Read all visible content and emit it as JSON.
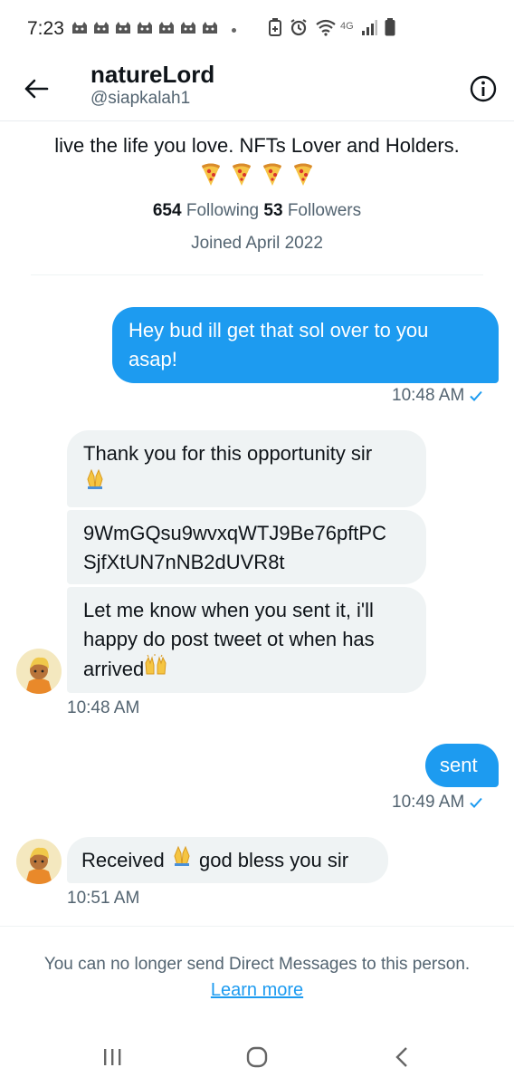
{
  "status_bar": {
    "time": "7:23",
    "network": "4G",
    "notification_icons": [
      "cat-icon",
      "cat-icon",
      "cat-icon",
      "cat-icon",
      "cat-icon",
      "cat-icon",
      "cat-icon"
    ]
  },
  "header": {
    "name": "natureLord",
    "handle": "@siapkalah1"
  },
  "profile": {
    "bio": "live the life you love.  NFTs Lover and Holders.",
    "bio_emoji": [
      "pizza",
      "pizza",
      "pizza",
      "pizza"
    ],
    "following_count": "654",
    "following_label": "Following",
    "followers_count": "53",
    "followers_label": "Followers",
    "joined": "Joined April 2022"
  },
  "messages": [
    {
      "direction": "sent",
      "lines": [
        "Hey bud ill get that sol over to you",
        "asap!"
      ],
      "time": "10:48 AM"
    },
    {
      "direction": "received",
      "lines": [
        "Thank you for this opportunity sir"
      ],
      "emoji": "folded-hands"
    },
    {
      "direction": "received",
      "lines": [
        "9WmGQsu9wvxqWTJ9Be76pftPC",
        "SjfXtUN7nNB2dUVR8t"
      ]
    },
    {
      "direction": "received",
      "lines": [
        "Let me know when you sent it, i'll",
        "happy do post tweet ot when has",
        "arrived"
      ],
      "emoji": "raising-hands",
      "time": "10:48 AM"
    },
    {
      "direction": "sent",
      "lines": [
        "sent"
      ],
      "time": "10:49 AM"
    },
    {
      "direction": "received",
      "lines": [
        "Received",
        "god bless you sir"
      ],
      "emoji": "folded-hands",
      "time": "10:51 AM"
    }
  ],
  "footer": {
    "notice": "You can no longer send Direct Messages to this person.",
    "link": "Learn more"
  },
  "colors": {
    "accent": "#1d9bf0",
    "received_bubble": "#eff3f4",
    "secondary_text": "#536471"
  }
}
